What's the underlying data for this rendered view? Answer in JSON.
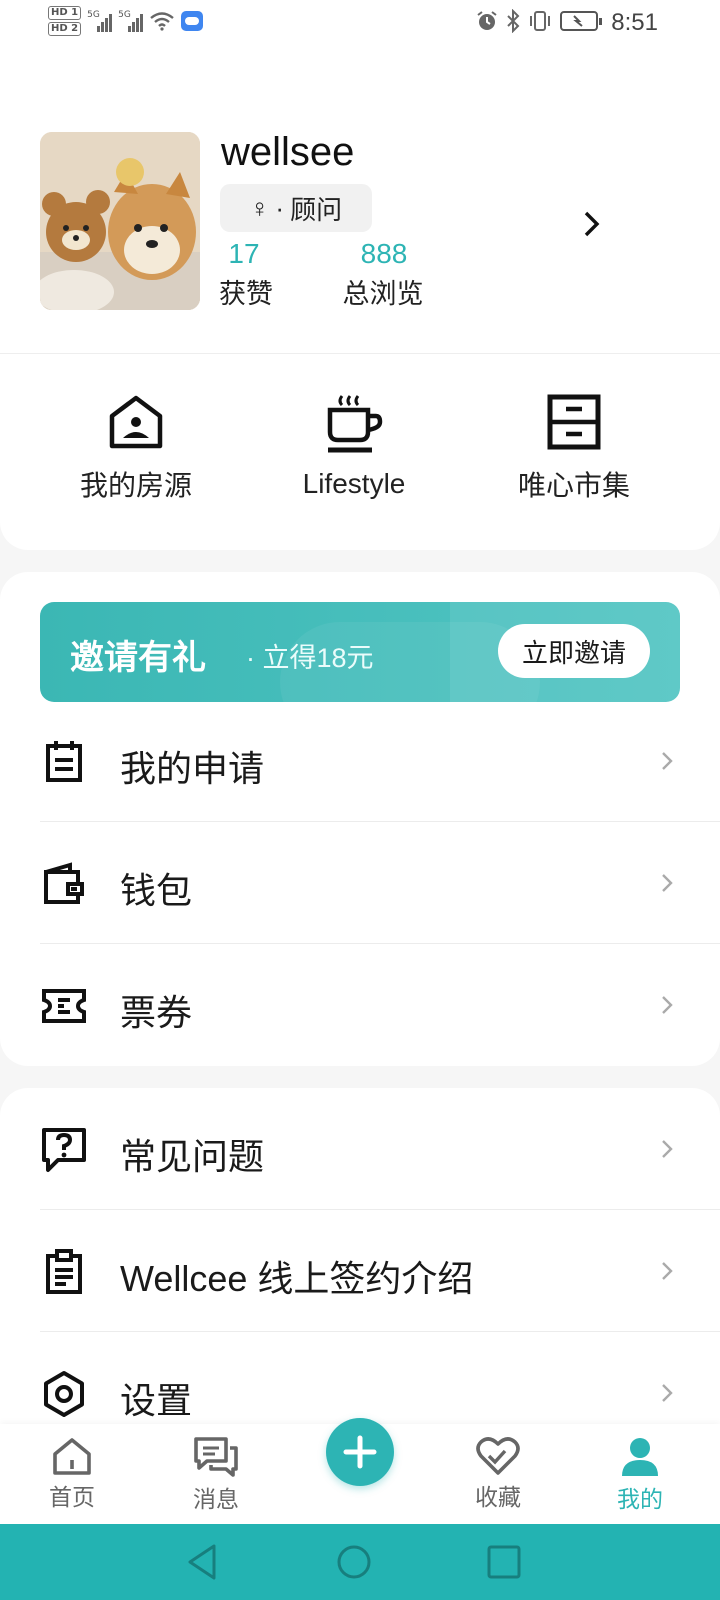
{
  "status_bar": {
    "time": "8:51",
    "sim1": "HD 1",
    "sim2": "HD 2",
    "net1": "5G",
    "net2": "5G",
    "icons": [
      "alarm-icon",
      "bluetooth-icon",
      "vibrate-icon",
      "battery-icon"
    ]
  },
  "profile": {
    "username": "wellsee",
    "gender_symbol": "♀",
    "separator": "·",
    "role": "顾问",
    "stats": [
      {
        "value": "17",
        "label": "获赞"
      },
      {
        "value": "888",
        "label": "总浏览"
      }
    ]
  },
  "shortcuts": [
    {
      "label": "我的房源",
      "icon": "house-user-icon"
    },
    {
      "label": "Lifestyle",
      "icon": "coffee-cup-icon"
    },
    {
      "label": "唯心市集",
      "icon": "cabinet-icon"
    }
  ],
  "invite_banner": {
    "title": "邀请有礼",
    "subtitle": "· 立得18元",
    "button": "立即邀请"
  },
  "menu_group_1": [
    {
      "label": "我的申请",
      "icon": "calendar-icon"
    },
    {
      "label": "钱包",
      "icon": "wallet-icon"
    },
    {
      "label": "票券",
      "icon": "ticket-icon"
    }
  ],
  "menu_group_2": [
    {
      "label": "常见问题",
      "icon": "question-chat-icon"
    },
    {
      "label": "Wellcee 线上签约介绍",
      "icon": "clipboard-icon"
    },
    {
      "label": "设置",
      "icon": "settings-icon"
    }
  ],
  "bottom_nav": [
    {
      "label": "首页",
      "icon": "home-icon"
    },
    {
      "label": "消息",
      "icon": "message-icon"
    },
    {
      "label": "收藏",
      "icon": "heart-icon"
    },
    {
      "label": "我的",
      "icon": "person-icon",
      "active": true
    }
  ],
  "colors": {
    "accent": "#2db4b4",
    "system_nav": "#23b3b2"
  }
}
